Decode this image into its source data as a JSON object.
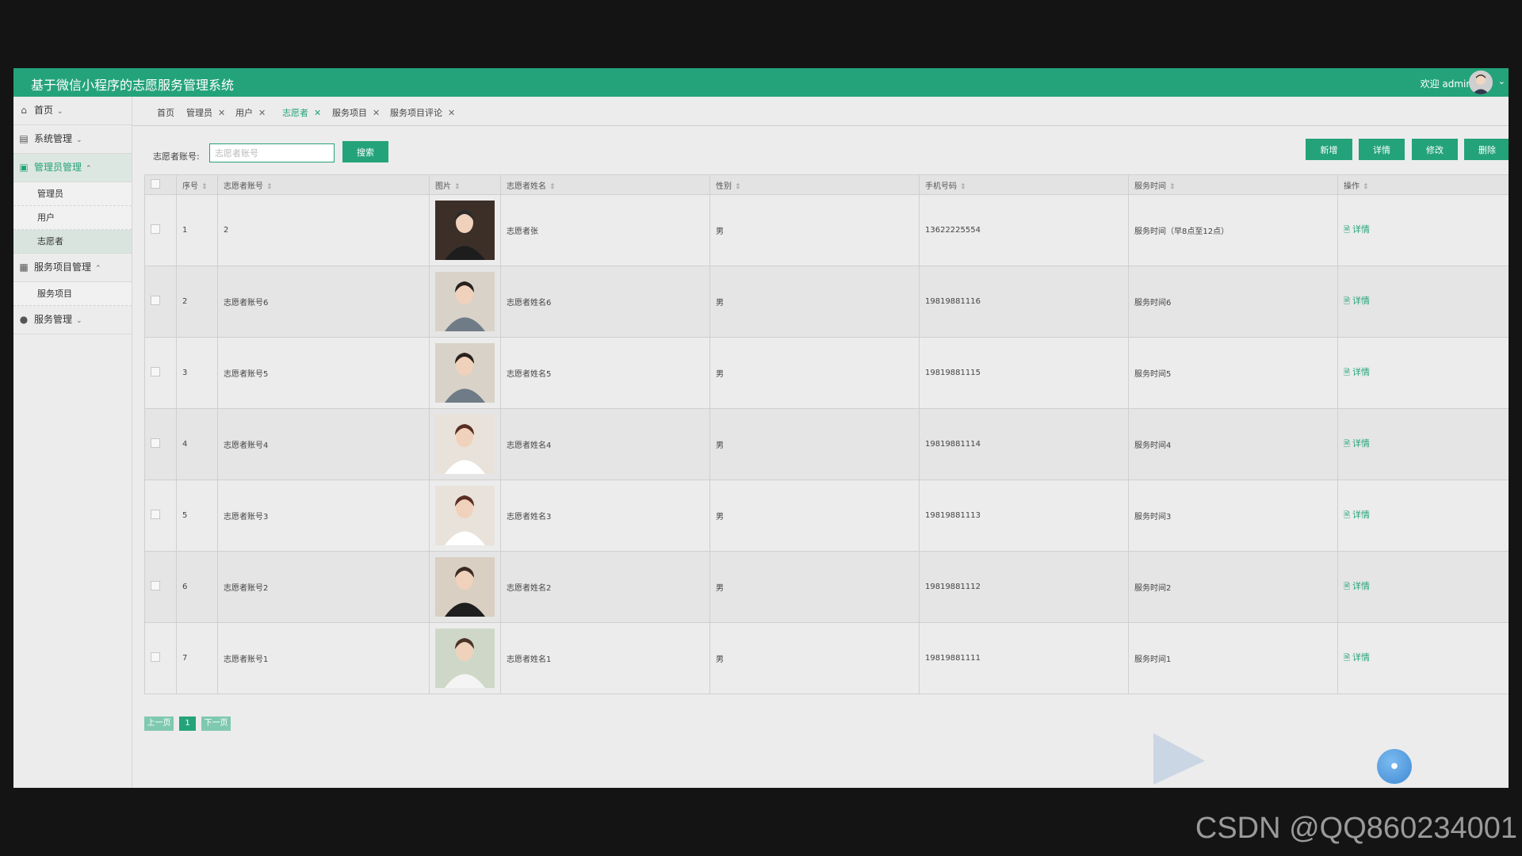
{
  "header": {
    "app_title": "基于微信小程序的志愿服务管理系统",
    "welcome": "欢迎 admin"
  },
  "sidebar": {
    "items": [
      {
        "label": "首页",
        "icon": "home-icon"
      },
      {
        "label": "系统管理",
        "icon": "server-icon"
      },
      {
        "label": "管理员管理",
        "icon": "briefcase-icon",
        "children": [
          "管理员",
          "用户",
          "志愿者"
        ]
      },
      {
        "label": "服务项目管理",
        "icon": "grid-icon",
        "children": [
          "服务项目"
        ]
      },
      {
        "label": "服务管理",
        "icon": "globe-icon"
      }
    ]
  },
  "tabs": [
    {
      "label": "首页",
      "closable": false
    },
    {
      "label": "管理员",
      "closable": true
    },
    {
      "label": "用户",
      "closable": true
    },
    {
      "label": "志愿者",
      "closable": true,
      "active": true
    },
    {
      "label": "服务项目",
      "closable": true
    },
    {
      "label": "服务项目评论",
      "closable": true
    }
  ],
  "search": {
    "label": "志愿者账号:",
    "placeholder": "志愿者账号",
    "button": "搜索"
  },
  "actions": {
    "add": "新增",
    "detail": "详情",
    "edit": "修改",
    "delete": "删除"
  },
  "table": {
    "columns": [
      "序号",
      "志愿者账号",
      "图片",
      "志愿者姓名",
      "性别",
      "手机号码",
      "服务时间",
      "操作"
    ],
    "rows": [
      {
        "no": "1",
        "account": "2",
        "name": "志愿者张",
        "gender": "男",
        "phone": "13622225554",
        "service_time": "服务时间（早8点至12点）",
        "action": "详情"
      },
      {
        "no": "2",
        "account": "志愿者账号6",
        "name": "志愿者姓名6",
        "gender": "男",
        "phone": "19819881116",
        "service_time": "服务时间6",
        "action": "详情"
      },
      {
        "no": "3",
        "account": "志愿者账号5",
        "name": "志愿者姓名5",
        "gender": "男",
        "phone": "19819881115",
        "service_time": "服务时间5",
        "action": "详情"
      },
      {
        "no": "4",
        "account": "志愿者账号4",
        "name": "志愿者姓名4",
        "gender": "男",
        "phone": "19819881114",
        "service_time": "服务时间4",
        "action": "详情"
      },
      {
        "no": "5",
        "account": "志愿者账号3",
        "name": "志愿者姓名3",
        "gender": "男",
        "phone": "19819881113",
        "service_time": "服务时间3",
        "action": "详情"
      },
      {
        "no": "6",
        "account": "志愿者账号2",
        "name": "志愿者姓名2",
        "gender": "男",
        "phone": "19819881112",
        "service_time": "服务时间2",
        "action": "详情"
      },
      {
        "no": "7",
        "account": "志愿者账号1",
        "name": "志愿者姓名1",
        "gender": "男",
        "phone": "19819881111",
        "service_time": "服务时间1",
        "action": "详情"
      }
    ]
  },
  "pagination": {
    "prev": "上一页",
    "current": "1",
    "next": "下一页"
  },
  "watermark": "CSDN @QQ860234001",
  "colors": {
    "accent": "#24a37a",
    "background": "#ececec"
  }
}
